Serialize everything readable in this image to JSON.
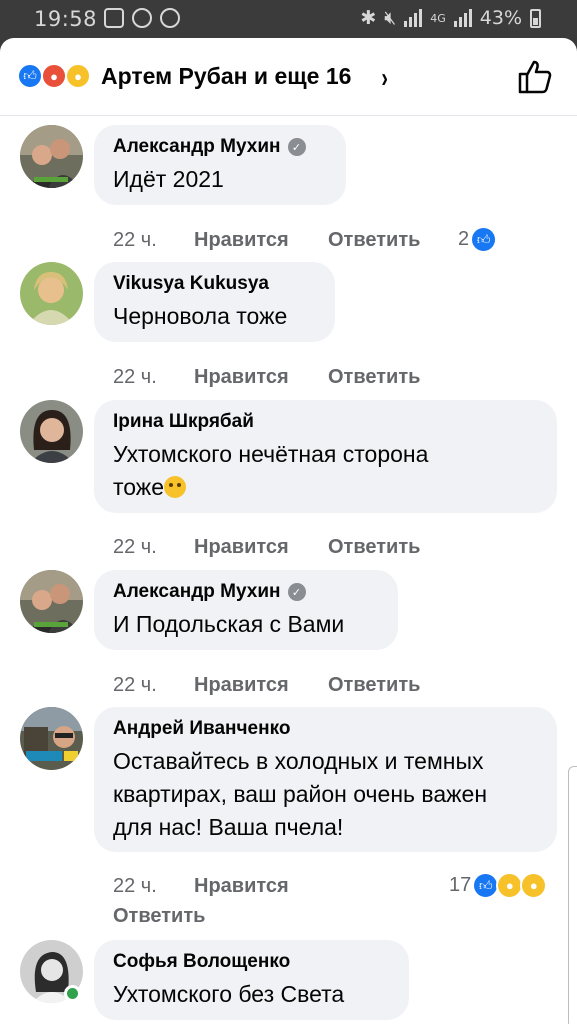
{
  "status_bar": {
    "time": "19:58",
    "network": "4G",
    "battery": "43%"
  },
  "header": {
    "reactions": [
      "like-icon",
      "angry-icon",
      "sad-icon"
    ],
    "title": "Артем Рубан и еще 16",
    "chevron": "›"
  },
  "comments": [
    {
      "author": "Александр Мухин",
      "verified": true,
      "text": "Идёт 2021",
      "time": "22 ч.",
      "like_label": "Нравится",
      "reply_label": "Ответить",
      "reaction_count": "2"
    },
    {
      "author": "Vikusya Kukusya",
      "verified": false,
      "text": "Черновола тоже",
      "time": "22 ч.",
      "like_label": "Нравится",
      "reply_label": "Ответить"
    },
    {
      "author": "Ірина Шкрябай",
      "verified": false,
      "text_line1": "Ухтомского нечётная сторона",
      "text_line2": "тоже",
      "time": "22 ч.",
      "like_label": "Нравится",
      "reply_label": "Ответить"
    },
    {
      "author": "Александр Мухин",
      "verified": true,
      "text": "И Подольская с Вами",
      "time": "22 ч.",
      "like_label": "Нравится",
      "reply_label": "Ответить"
    },
    {
      "author": "Андрей Иванченко",
      "verified": false,
      "text_line1": "Оставайтесь в холодных и темных",
      "text_line2": "квартирах, ваш район очень важен",
      "text_line3": "для нас! Ваша пчела!",
      "time": "22 ч.",
      "like_label": "Нравится",
      "reply_label": "Ответить",
      "reaction_count": "17"
    },
    {
      "author": "Софья Волощенко",
      "verified": false,
      "text": "Ухтомского без Света",
      "online": true
    }
  ],
  "colors": {
    "accent": "#1877f2",
    "bubble": "#f0f2f5",
    "meta_text": "#65676b"
  }
}
